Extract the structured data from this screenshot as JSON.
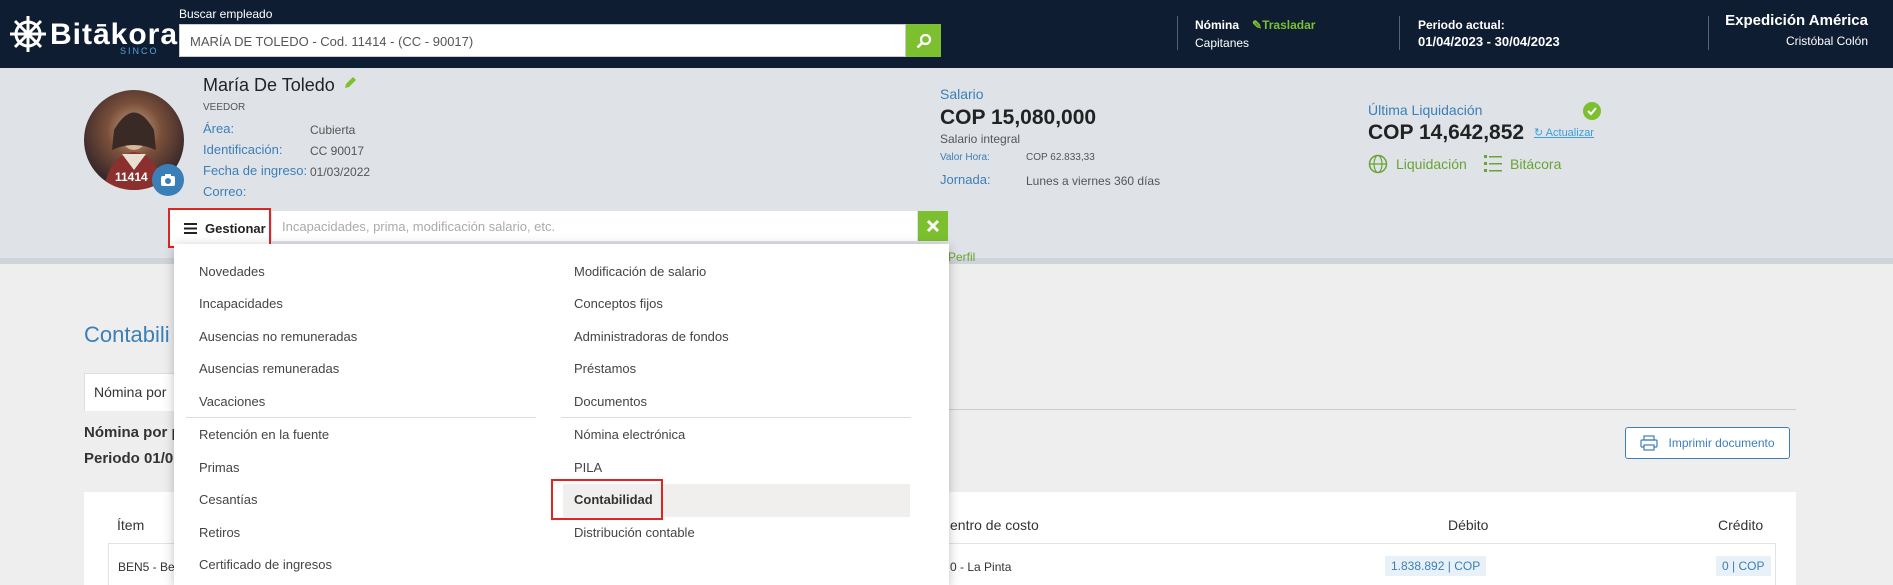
{
  "header": {
    "logo_text": "Bitākora",
    "logo_sub": "SINCO",
    "search_label": "Buscar empleado",
    "search_value": "MARÍA DE TOLEDO - Cod. 11414 - (CC - 90017)",
    "nomina_label": "Nómina",
    "trasladar_label": "Trasladar",
    "nomina_value": "Capitanes",
    "periodo_label": "Periodo actual:",
    "periodo_value": "01/04/2023 - 30/04/2023",
    "company": "Expedición América",
    "user": "Cristóbal Colón"
  },
  "profile": {
    "name": "María De Toledo",
    "role": "VEEDOR",
    "code": "11414",
    "area_label": "Área:",
    "area_value": "Cubierta",
    "id_label": "Identificación:",
    "id_value": "CC 90017",
    "ingreso_label": "Fecha de ingreso:",
    "ingreso_value": "01/03/2022",
    "correo_label": "Correo:",
    "correo_value": ""
  },
  "salary": {
    "label": "Salario",
    "value": "COP 15,080,000",
    "type": "Salario integral",
    "valor_hora_label": "Valor Hora:",
    "valor_hora_value": "COP 62.833,33",
    "jornada_label": "Jornada:",
    "jornada_value": "Lunes a viernes 360 días"
  },
  "liquidation": {
    "label": "Última Liquidación",
    "value": "COP 14,642,852",
    "actualizar": "Actualizar",
    "liquidacion_link": "Liquidación",
    "bitacora_link": "Bitácora"
  },
  "perfil_link": "Perfil",
  "gestionar": {
    "button_label": "Gestionar",
    "placeholder": "Incapacidades, prima, modificación salario, etc."
  },
  "menu": {
    "left": [
      "Novedades",
      "Incapacidades",
      "Ausencias no remuneradas",
      "Ausencias remuneradas",
      "Vacaciones",
      "Retención en la fuente",
      "Primas",
      "Cesantías",
      "Retiros",
      "Certificado de ingresos"
    ],
    "right": [
      "Modificación de salario",
      "Conceptos fijos",
      "Administradoras de fondos",
      "Préstamos",
      "Documentos",
      "Nómina electrónica",
      "PILA",
      "Contabilidad",
      "Distribución contable"
    ]
  },
  "content": {
    "title": "Contabili",
    "tab": "Nómina por",
    "line1": "Nómina por p",
    "line2": "Periodo 01/0",
    "print_button": "Imprimir documento",
    "col_item": "Ítem",
    "col_centro": "entro de costo",
    "col_debito": "Débito",
    "col_credito": "Crédito",
    "row_item": "BEN5 - Be",
    "row_centro": "0 - La Pinta",
    "row_debito": "1.838.892",
    "row_credito": "0",
    "currency": "COP"
  },
  "colors": {
    "topbar": "#0f1d33",
    "accent_green": "#7cbf2f",
    "accent_blue": "#3b7fb8",
    "highlight_red": "#e02424"
  }
}
